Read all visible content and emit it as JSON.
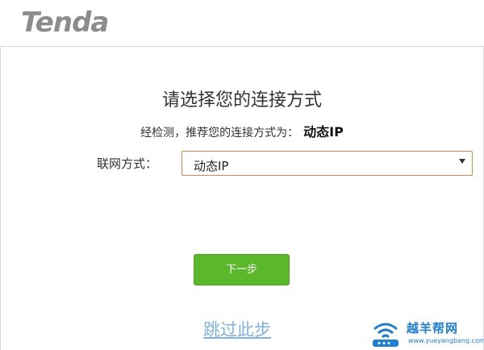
{
  "header": {
    "logo_text": "Tenda"
  },
  "main": {
    "title": "请选择您的连接方式",
    "detect_label": "经检测，推荐您的连接方式为：",
    "detect_result": "动态IP",
    "mode_label": "联网方式：",
    "mode_select": {
      "value": "动态IP"
    },
    "next_button": "下一步",
    "skip_link": "跳过此步"
  },
  "watermark": {
    "title": "越羊帮网",
    "url": "www.yueyangbang.com",
    "icon": "wifi-router-icon"
  },
  "colors": {
    "accent_green": "#5bb82a",
    "select_border": "#e0884a",
    "link_blue": "#7fb1e0",
    "logo_gray": "#8c8c8c"
  }
}
